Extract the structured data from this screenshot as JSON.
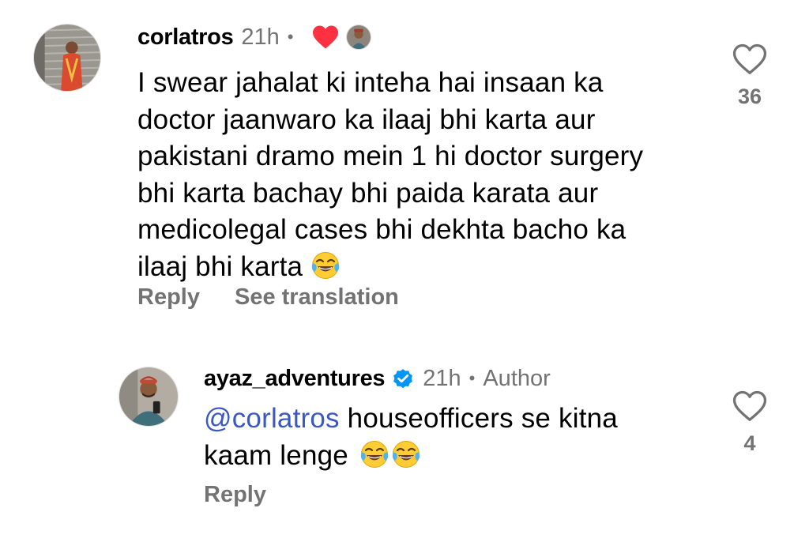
{
  "comments": [
    {
      "username": "corlatros",
      "time": "21h",
      "separator": "•",
      "text": "I swear jahalat ki inteha hai insaan ka doctor jaanwaro ka ilaaj bhi karta aur pakistani dramo mein 1 hi doctor surgery bhi karta bachay bhi paida karata aur medicolegal cases bhi dekhta bacho ka ilaaj bhi karta",
      "lines": [
        "I swear jahalat ki inteha hai insaan ka",
        "doctor jaanwaro ka ilaaj bhi karta aur",
        "pakistani dramo mein 1 hi doctor surgery",
        "bhi karta bachay bhi paida karata aur",
        "medicolegal cases bhi dekhta bacho ka",
        "ilaaj bhi karta"
      ],
      "emoji": [
        "face-with-tears-of-joy"
      ],
      "reply_label": "Reply",
      "translate_label": "See translation",
      "like_count": "36",
      "liked_by_author": true
    },
    {
      "username": "ayaz_adventures",
      "verified": true,
      "time": "21h",
      "separator": "•",
      "author_label": "Author",
      "mention": "@corlatros",
      "line1_rest": " houseofficers se kitna",
      "line2": "kaam lenge",
      "emoji": [
        "face-with-tears-of-joy",
        "face-with-tears-of-joy"
      ],
      "reply_label": "Reply",
      "like_count": "4"
    }
  ],
  "colors": {
    "text": "#000000",
    "secondary": "#737373",
    "mention": "#3a57c4",
    "heart_red": "#ff3040",
    "verified_blue": "#0095f6"
  }
}
